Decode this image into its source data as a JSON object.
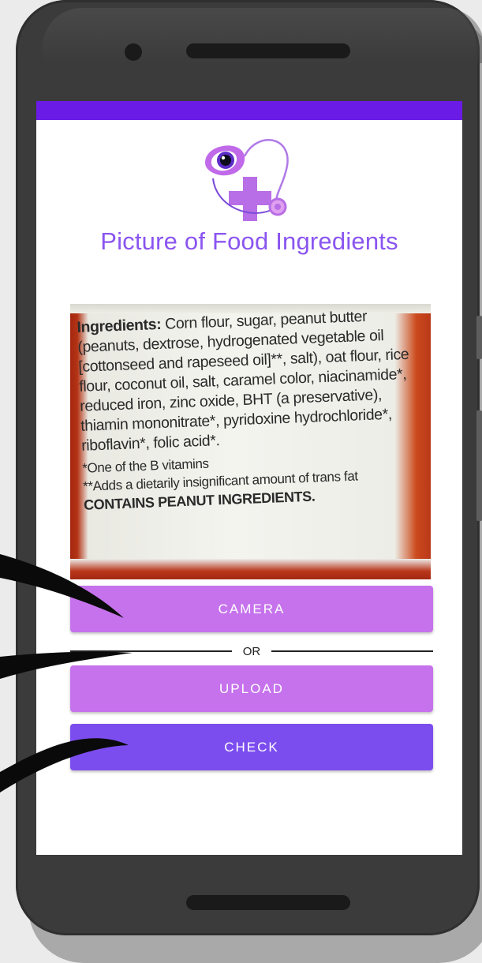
{
  "app": {
    "title": "Picture of Food Ingredients"
  },
  "ingredients_image": {
    "heading": "Ingredients:",
    "body": "Corn flour, sugar, peanut butter (peanuts, dextrose, hydrogenated vegetable oil [cottonseed and rapeseed oil]**, salt), oat flour, rice flour, coconut oil, salt, caramel color, niacinamide*, reduced iron, zinc oxide, BHT (a preservative), thiamin mononitrate*, pyridoxine hydrochloride*, riboflavin*, folic acid*.",
    "note1": "*One of the B vitamins",
    "note2": "**Adds a dietarily insignificant amount of trans fat",
    "allergen": "CONTAINS PEANUT INGREDIENTS."
  },
  "buttons": {
    "camera": "CAMERA",
    "or": "OR",
    "upload": "UPLOAD",
    "check": "CHECK"
  },
  "colors": {
    "status_bar": "#6a1be6",
    "title": "#8a55f0",
    "light_button": "#c672ec",
    "primary_button": "#7c4dee"
  },
  "icons": {
    "logo": "eye-and-medical-cross-with-stethoscope-logo"
  }
}
